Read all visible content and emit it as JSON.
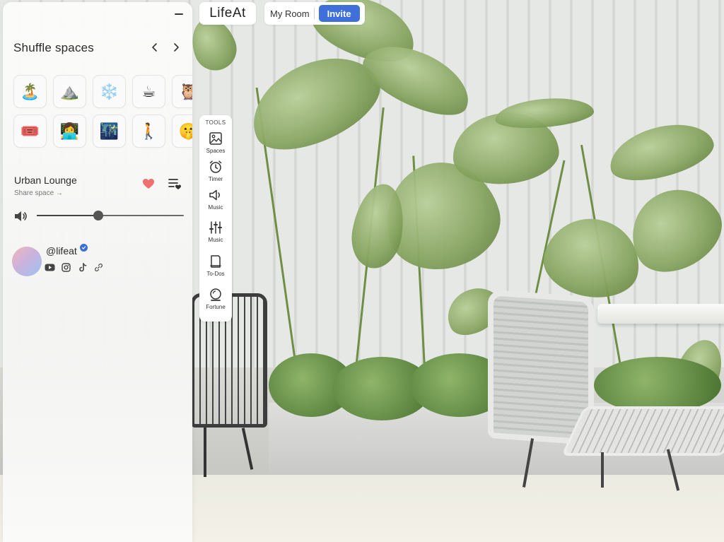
{
  "topbar": {
    "logo": "LifeAt",
    "room_label": "My Room",
    "invite_label": "Invite"
  },
  "panel": {
    "title": "Shuffle spaces",
    "tiles_row1": [
      "🏝️",
      "⛰️",
      "❄️",
      "☕",
      "🦉"
    ],
    "tiles_row2": [
      "🎟️",
      "👩‍💻",
      "🌃",
      "🚶",
      "🤫"
    ],
    "space_name": "Urban Lounge",
    "share_label": "Share space →",
    "volume": 0.42,
    "profile": {
      "handle": "@lifeat"
    }
  },
  "tools": {
    "title": "TOOLS",
    "items": [
      {
        "label": "Spaces",
        "icon": "image-icon"
      },
      {
        "label": "Timer",
        "icon": "alarm-clock-icon"
      },
      {
        "label": "Music",
        "icon": "speaker-icon"
      },
      {
        "label": "Music",
        "icon": "sliders-icon"
      },
      {
        "label": "To-Dos",
        "icon": "notepad-icon"
      },
      {
        "label": "Fortune",
        "icon": "crystal-ball-icon"
      }
    ]
  },
  "colors": {
    "accent": "#3f6fd8",
    "heart": "#f07070",
    "verified": "#3a6fd6"
  }
}
